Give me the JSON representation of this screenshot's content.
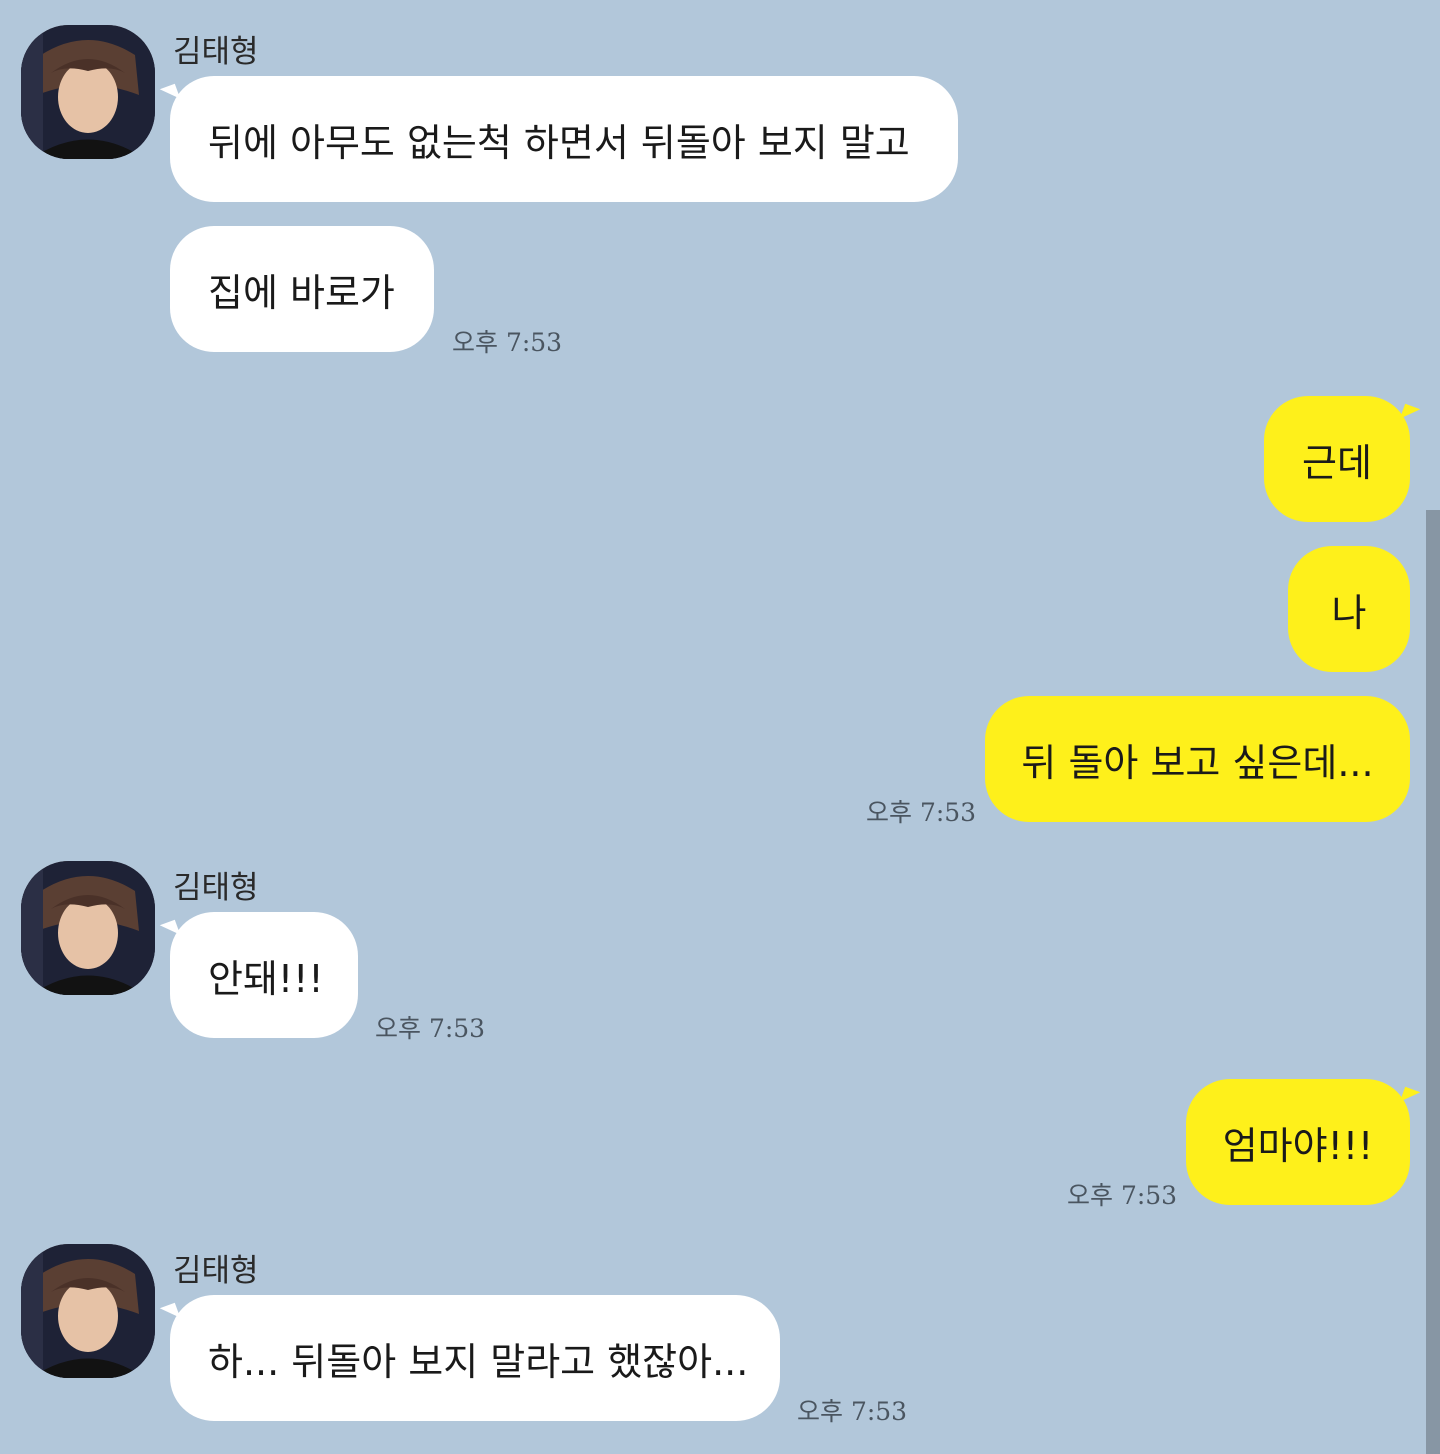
{
  "chat": {
    "sender_name": "김태형",
    "messages": [
      {
        "text": "뒤에 아무도 없는척 하면서 뒤돌아 보지 말고"
      },
      {
        "text": "집에 바로가",
        "time": "오후 7:53"
      },
      {
        "text": "근데"
      },
      {
        "text": "나"
      },
      {
        "text": "뒤 돌아 보고 싶은데...",
        "time": "오후 7:53"
      },
      {
        "text": "안돼!!!",
        "time": "오후 7:53"
      },
      {
        "text": "엄마야!!!",
        "time": "오후 7:53"
      },
      {
        "text": "하... 뒤돌아 보지 말라고 했잖아...",
        "time": "오후 7:53"
      }
    ]
  },
  "colors": {
    "background": "#b2c7da",
    "incoming_bubble": "#ffffff",
    "outgoing_bubble": "#fef01b"
  }
}
